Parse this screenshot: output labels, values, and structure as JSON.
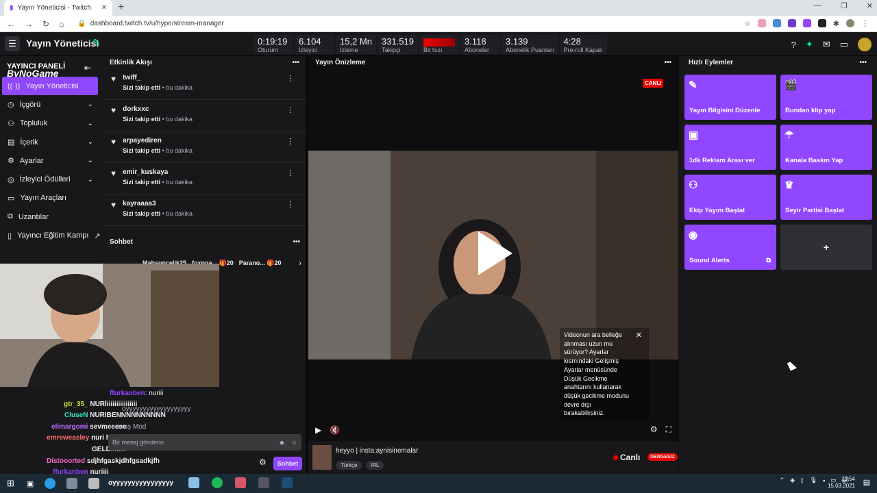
{
  "browser": {
    "tab_title": "Yayın Yöneticisi - Twitch",
    "url": "dashboard.twitch.tv/u/hype/stream-manager"
  },
  "topnav": {
    "title": "Yayın Yöneticisi",
    "stats": [
      {
        "value": "0:19:19",
        "label": "Oturum"
      },
      {
        "value": "6.104",
        "label": "İzleyici"
      },
      {
        "value": "15,2 Mn",
        "label": "İzleme"
      },
      {
        "value": "331.519",
        "label": "Takipçi"
      },
      {
        "value": "",
        "label": "Bit hızı"
      },
      {
        "value": "3.118",
        "label": "Aboneler"
      },
      {
        "value": "3.139",
        "label": "Abonelik Puanları"
      },
      {
        "value": "4:28",
        "label": "Pre-roll Kapalı"
      }
    ]
  },
  "sidebar": {
    "brand_label": "YAYINCI PANELİ",
    "brand_logo": "ByNoGame",
    "items": [
      {
        "label": "Yayın Yöneticisi",
        "icon": "broadcast-icon",
        "chevron": false
      },
      {
        "label": "İçgörü",
        "icon": "insights-icon",
        "chevron": true
      },
      {
        "label": "Topluluk",
        "icon": "community-icon",
        "chevron": true
      },
      {
        "label": "İçerik",
        "icon": "content-icon",
        "chevron": true
      },
      {
        "label": "Ayarlar",
        "icon": "settings-icon",
        "chevron": true
      },
      {
        "label": "İzleyici Ödülleri",
        "icon": "rewards-icon",
        "chevron": true
      },
      {
        "label": "Yayın Araçları",
        "icon": "tools-icon",
        "chevron": false
      },
      {
        "label": "Uzantılar",
        "icon": "extensions-icon",
        "chevron": false
      },
      {
        "label": "Yayıncı Eğitim Kampı",
        "icon": "bootcamp-icon",
        "chevron": false
      }
    ]
  },
  "feed": {
    "title": "Etkinlik Akışı",
    "items": [
      {
        "name": "twiff_",
        "action": "Sizi takip etti",
        "time": "• bu dakika"
      },
      {
        "name": "dorkxxc",
        "action": "Sizi takip etti",
        "time": "• bu dakika"
      },
      {
        "name": "arpayediren",
        "action": "Sizi takip etti",
        "time": "• bu dakika"
      },
      {
        "name": "emir_kuskaya",
        "action": "Sizi takip etti",
        "time": "• bu dakika"
      },
      {
        "name": "kayraaaa3",
        "action": "Sizi takip etti",
        "time": "• bu dakika"
      }
    ]
  },
  "chat": {
    "title": "Sohbet",
    "gifts": [
      {
        "user": "Mahsuncelik25",
        "count": ""
      },
      {
        "user": "foxnga...",
        "count": "20"
      },
      {
        "user": "Parano...",
        "count": "20"
      }
    ],
    "messages": [
      {
        "user": "ffurkanben",
        "text": ": nuriii",
        "color": "#9147ff"
      },
      {
        "user": "",
        "text": "oyyyyyyyyyyyyyyyyyyy",
        "color": "#adadb8"
      },
      {
        "user": "gtr_35_",
        "text": "NURİiiiiiiiiiiiiiiii",
        "color": "#c8e63c"
      },
      {
        "user": "CluseN",
        "text": "NURIBENNNNNNNNNN",
        "color": "#3ce6c8"
      },
      {
        "user": "elimargomi",
        "text": "sevmeeeee",
        "color": "#c06bff"
      },
      {
        "user": "emreweasley",
        "text": "nuri hg",
        "color": "#ff6b6b"
      },
      {
        "user": "",
        "text": "GELDİİİİİİİİ",
        "color": "#5a5aff"
      },
      {
        "user": "Distooorted",
        "text": "sdjhfgaskjdhfgsadkjfh",
        "color": "#ff66cc"
      },
      {
        "user": "ffurkanben",
        "text": "nuriiii",
        "color": "#9147ff"
      }
    ],
    "mod_text": "avaş Mod",
    "input_placeholder": "Bir mesaj gönderin",
    "send_label": "Sohbet"
  },
  "preview": {
    "title": "Yayın Önizleme",
    "live_badge": "CANLI",
    "tooltip": "Videonun ara belleğe alınması uzun mu sürüyor? Ayarlar kısmındaki Gelişmiş Ayarlar menüsünde Düşük Gecikme anahtarını kullanarak düşük gecikme modunu devre dışı bırakabilirsiniz.",
    "stream_title": "heyyo | insta:aynisinemalar",
    "tags": [
      "Türkçe",
      "IRL"
    ],
    "status": "Canlı",
    "stability": "DENGESİZ"
  },
  "quick": {
    "title": "Hızlı Eylemler",
    "actions": [
      {
        "label": "Yayın Bilgisini Düzenle",
        "icon": "pencil-icon"
      },
      {
        "label": "Bundan klip yap",
        "icon": "clip-icon"
      },
      {
        "label": "1dk Reklam Arası ver",
        "icon": "ad-icon"
      },
      {
        "label": "Kanala Baskın Yap",
        "icon": "raid-icon"
      },
      {
        "label": "Ekip Yayını Başlat",
        "icon": "squad-icon"
      },
      {
        "label": "Seyir Partisi Başlat",
        "icon": "crown-icon"
      },
      {
        "label": "Sound Alerts",
        "icon": "sound-alerts-icon"
      }
    ],
    "add_label": "+"
  },
  "taskbar": {
    "overlay_text": "oyyyyyyyyyyyyyyyy",
    "time": "23:54",
    "date": "15.03.2021"
  }
}
